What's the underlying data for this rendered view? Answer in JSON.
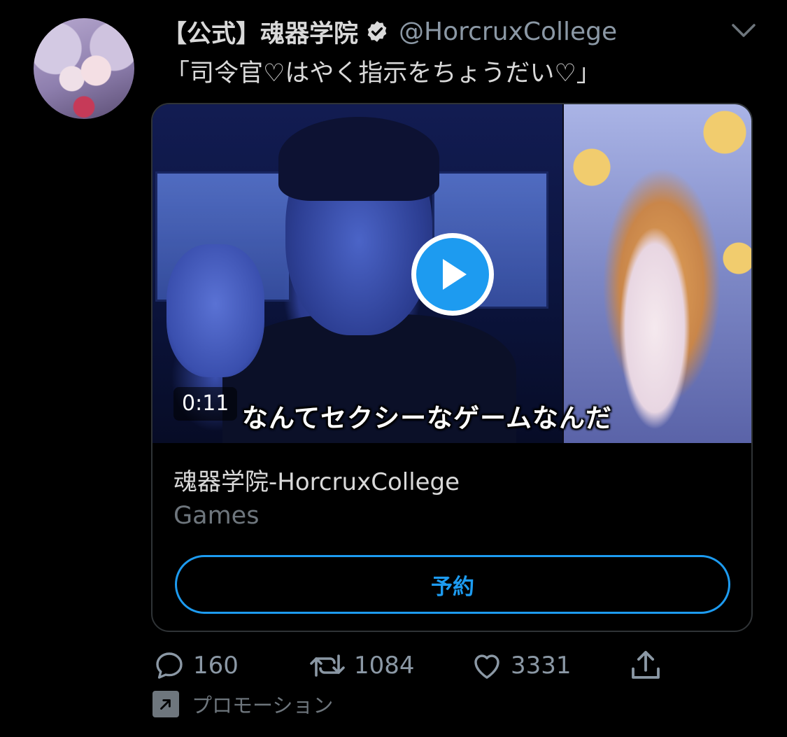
{
  "tweet": {
    "display_name": "【公式】魂器学院",
    "handle": "@HorcruxCollege",
    "text": "「司令官♡はやく指示をちょうだい♡」",
    "verified": true
  },
  "card": {
    "video_duration": "0:11",
    "video_subtitle": "なんてセクシーなゲームなんだ",
    "app_title": "魂器学院-HorcruxCollege",
    "category": "Games",
    "cta_label": "予約"
  },
  "actions": {
    "reply_count": "160",
    "retweet_count": "1084",
    "like_count": "3331"
  },
  "promoted_label": "プロモーション",
  "icons": {
    "verified": "verified-badge-icon",
    "caret": "chevron-down-icon",
    "play": "play-icon",
    "reply": "reply-icon",
    "retweet": "retweet-icon",
    "like": "heart-icon",
    "share": "share-icon",
    "promoted": "promoted-arrow-icon"
  },
  "colors": {
    "background": "#000000",
    "accent": "#1d9bf0",
    "text_primary": "#d9d9d9",
    "text_secondary": "#8b98a5"
  }
}
